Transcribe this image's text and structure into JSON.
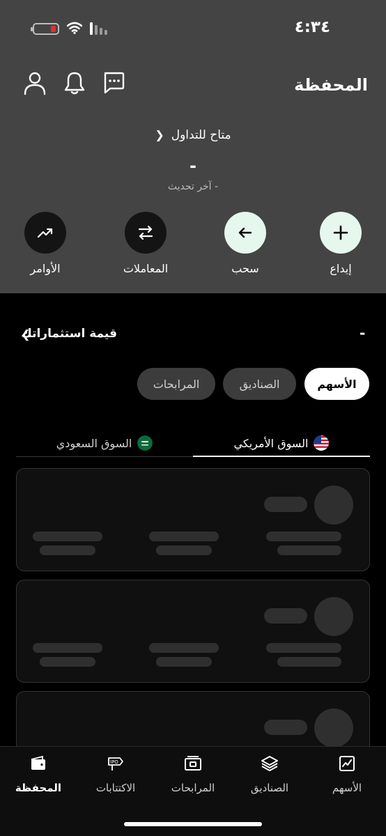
{
  "status_bar": {
    "time": "٤:٣٤"
  },
  "header": {
    "title": "المحفظة"
  },
  "account": {
    "available_label": "متاح للتداول",
    "balance": "-",
    "last_update": "آخر تحديث -"
  },
  "actions": {
    "deposit": "إيداع",
    "withdraw": "سحب",
    "transactions": "المعاملات",
    "orders": "الأوامر"
  },
  "investments": {
    "title": "قيمة استثماراتك",
    "value": "-"
  },
  "asset_tabs": [
    {
      "label": "الأسهم",
      "active": true
    },
    {
      "label": "الصناديق",
      "active": false
    },
    {
      "label": "المرابحات",
      "active": false
    }
  ],
  "market_tabs": [
    {
      "label": "السوق الأمريكي",
      "active": true
    },
    {
      "label": "السوق السعودي",
      "active": false
    }
  ],
  "bottom_nav": [
    {
      "label": "الأسهم",
      "icon": "chart-icon"
    },
    {
      "label": "الصناديق",
      "icon": "layers-icon"
    },
    {
      "label": "المرابحات",
      "icon": "murabaha-icon"
    },
    {
      "label": "الاكتتابات",
      "icon": "ipo-icon"
    },
    {
      "label": "المحفظة",
      "icon": "wallet-icon",
      "active": true
    }
  ],
  "colors": {
    "top_panel": "#444444",
    "background": "#000000",
    "action_light": "#e6f7ee",
    "action_dark": "#141414",
    "battery_low": "#e0302a"
  }
}
